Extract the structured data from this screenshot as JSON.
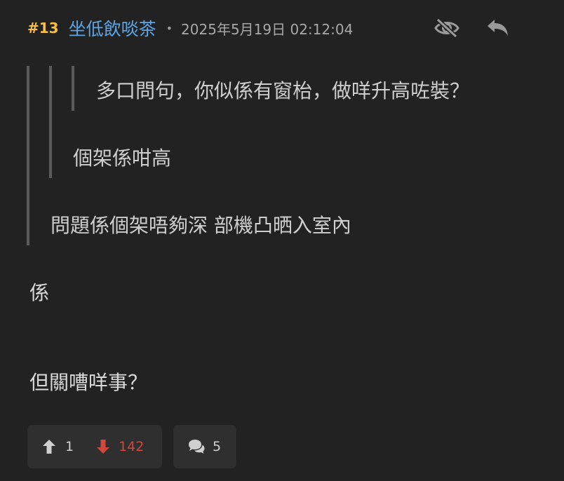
{
  "post": {
    "number": "#13",
    "username": "坐低飲啖茶",
    "separator": "•",
    "timestamp": "2025年5月19日 02:12:04",
    "icons": {
      "hide": "eye-slash-icon",
      "reply": "reply-icon"
    }
  },
  "quotes": {
    "level3": "多口問句，你似係有窗枱，做咩升高咗裝？",
    "level2": "個架係咁高",
    "level1": "問題係個架唔夠深 部機凸晒入室內"
  },
  "body": {
    "line1": "係",
    "line2": "但關嘈咩事？"
  },
  "actions": {
    "upvotes": "1",
    "downvotes": "142",
    "comments": "5",
    "icons": {
      "upvote": "arrow-up-icon",
      "downvote": "arrow-down-icon",
      "comments": "comments-icon"
    }
  },
  "colors": {
    "background": "#222222",
    "post_number": "#f5c045",
    "username": "#5da6e6",
    "downvote": "#d0483a",
    "action_box": "#2f2f2f",
    "quote_bar": "#5a5a5a"
  }
}
